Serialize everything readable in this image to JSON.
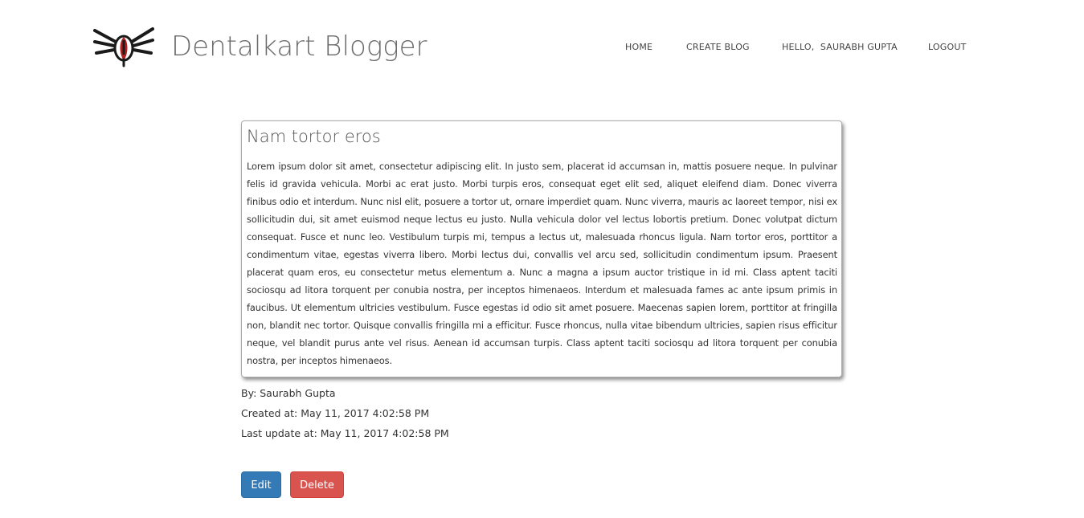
{
  "header": {
    "brand": "Dentalkart Blogger",
    "logo_icon": "winged-tooth-logo-icon",
    "logo_colors": {
      "wings": "#1a1a1a",
      "accent": "#b22222"
    }
  },
  "nav": {
    "home": "HOME",
    "create_blog": "CREATE BLOG",
    "hello": "HELLO,  SAURABH GUPTA",
    "logout": "LOGOUT"
  },
  "post": {
    "title": "Nam tortor eros",
    "body": "Lorem ipsum dolor sit amet, consectetur adipiscing elit. In justo sem, placerat id accumsan in, mattis posuere neque. In pulvinar felis id gravida vehicula. Morbi ac erat justo. Morbi turpis eros, consequat eget elit sed, aliquet eleifend diam. Donec viverra finibus odio et interdum. Nunc nisl elit, posuere a tortor ut, ornare imperdiet quam. Nunc viverra, mauris ac laoreet tempor, nisi ex sollicitudin dui, sit amet euismod neque lectus eu justo. Nulla vehicula dolor vel lectus lobortis pretium. Donec volutpat dictum consequat. Fusce et nunc leo. Vestibulum turpis mi, tempus a lectus ut, malesuada rhoncus ligula. Nam tortor eros, porttitor a condimentum vitae, egestas viverra libero. Morbi lectus dui, convallis vel arcu sed, sollicitudin condimentum ipsum. Praesent placerat quam eros, eu consectetur metus elementum a. Nunc a magna a ipsum auctor tristique in id mi. Class aptent taciti sociosqu ad litora torquent per conubia nostra, per inceptos himenaeos. Interdum et malesuada fames ac ante ipsum primis in faucibus. Ut elementum ultricies vestibulum. Fusce egestas id odio sit amet posuere. Maecenas sapien lorem, porttitor at fringilla non, blandit nec tortor. Quisque convallis fringilla mi a efficitur. Fusce rhoncus, nulla vitae bibendum ultricies, sapien risus efficitur neque, vel blandit purus ante vel risus. Aenean id accumsan turpis. Class aptent taciti sociosqu ad litora torquent per conubia nostra, per inceptos himenaeos.",
    "author": "By: Saurabh Gupta",
    "created": "Created at: May 11, 2017 4:02:58 PM",
    "updated": "Last update at: May 11, 2017 4:02:58 PM"
  },
  "actions": {
    "edit_label": "Edit",
    "delete_label": "Delete",
    "edit_color": "#337ab7",
    "delete_color": "#d9534f"
  }
}
